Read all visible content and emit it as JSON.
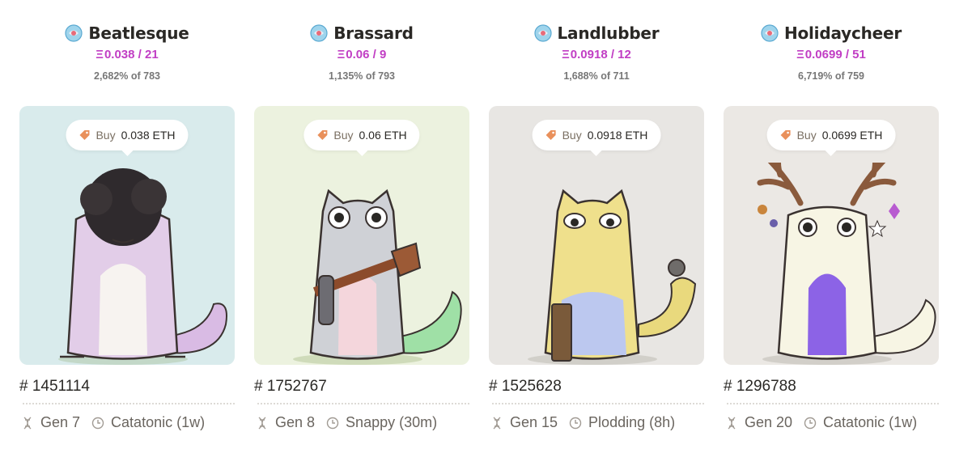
{
  "cards": [
    {
      "name": "Beatlesque",
      "price_line": "0.038 / 21",
      "stat_line": "2,682% of 783",
      "buy_label": "Buy",
      "buy_price": "0.038 ETH",
      "id": "# 1451114",
      "gen": "Gen 7",
      "cooldown": "Catatonic (1w)",
      "bg": "#d9ebec",
      "body_color": "#e2cde8",
      "belly_color": "#f7f3f0",
      "icon": "cattribute-badge-icon"
    },
    {
      "name": "Brassard",
      "price_line": "0.06 / 9",
      "stat_line": "1,135% of 793",
      "buy_label": "Buy",
      "buy_price": "0.06 ETH",
      "id": "# 1752767",
      "gen": "Gen 8",
      "cooldown": "Snappy (30m)",
      "bg": "#ecf2df",
      "body_color": "#cfd1d6",
      "belly_color": "#f4d6dc",
      "icon": "cattribute-badge-icon"
    },
    {
      "name": "Landlubber",
      "price_line": "0.0918 / 12",
      "stat_line": "1,688% of 711",
      "buy_label": "Buy",
      "buy_price": "0.0918 ETH",
      "id": "# 1525628",
      "gen": "Gen 15",
      "cooldown": "Plodding (8h)",
      "bg": "#e8e6e3",
      "body_color": "#efe08c",
      "belly_color": "#bcc8ef",
      "icon": "cattribute-badge-icon"
    },
    {
      "name": "Holidaycheer",
      "price_line": "0.0699 / 51",
      "stat_line": "6,719% of 759",
      "buy_label": "Buy",
      "buy_price": "0.0699 ETH",
      "id": "# 1296788",
      "gen": "Gen 20",
      "cooldown": "Catatonic (1w)",
      "bg": "#ebe8e4",
      "body_color": "#f7f5e4",
      "belly_color": "#8c63e6",
      "icon": "cattribute-badge-icon"
    }
  ],
  "currency_symbol": "Ξ",
  "colors": {
    "price": "#c13ec4",
    "text": "#2a2825",
    "muted": "#6a655f"
  }
}
